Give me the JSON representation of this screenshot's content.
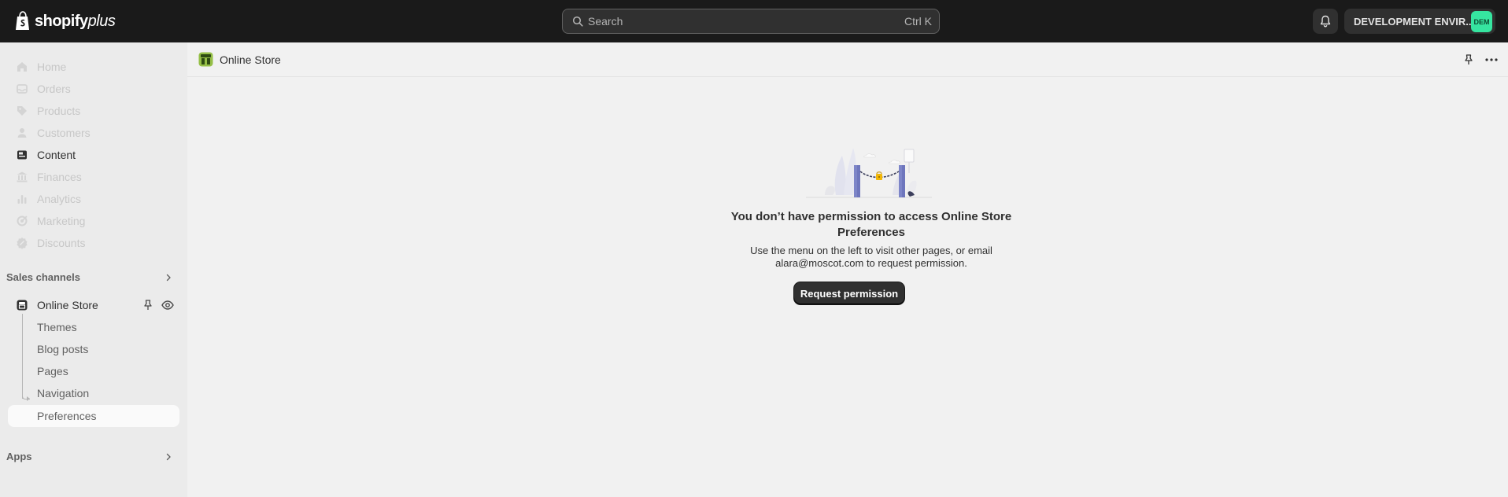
{
  "topbar": {
    "logo_text": "shopify",
    "logo_plus": "plus",
    "search_placeholder": "Search",
    "search_shortcut": "Ctrl K",
    "store_name": "DEVELOPMENT ENVIR...",
    "store_avatar": "DEM",
    "avatar_color": "#36e5a0"
  },
  "sidebar": {
    "items": [
      {
        "label": "Home",
        "icon": "home-icon",
        "disabled": true
      },
      {
        "label": "Orders",
        "icon": "inbox-icon",
        "disabled": true
      },
      {
        "label": "Products",
        "icon": "tag-icon",
        "disabled": true
      },
      {
        "label": "Customers",
        "icon": "person-icon",
        "disabled": true
      },
      {
        "label": "Content",
        "icon": "image-icon",
        "disabled": false
      },
      {
        "label": "Finances",
        "icon": "bank-icon",
        "disabled": true
      },
      {
        "label": "Analytics",
        "icon": "bar-chart-icon",
        "disabled": true
      },
      {
        "label": "Marketing",
        "icon": "target-icon",
        "disabled": true
      },
      {
        "label": "Discounts",
        "icon": "discount-icon",
        "disabled": true
      }
    ],
    "sales_channels_label": "Sales channels",
    "online_store_label": "Online Store",
    "sub_items": [
      {
        "label": "Themes"
      },
      {
        "label": "Blog posts"
      },
      {
        "label": "Pages"
      },
      {
        "label": "Navigation"
      },
      {
        "label": "Preferences"
      }
    ],
    "apps_label": "Apps"
  },
  "main": {
    "page_title": "Online Store",
    "empty_state": {
      "title": "You don’t have permission to access Online Store Preferences",
      "body": "Use the menu on the left to visit other pages, or email alara@moscot.com to request permission.",
      "button_label": "Request permission"
    }
  },
  "colors": {
    "topbar_bg": "#1a1a1a",
    "sidebar_bg": "#ebebeb",
    "main_bg": "#f1f1f1",
    "primary_button": "#303030"
  }
}
